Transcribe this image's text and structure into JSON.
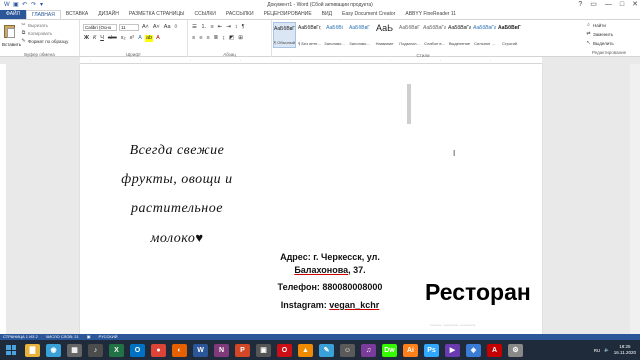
{
  "window": {
    "title": "Документ1 - Word (Сбой активации продукта)",
    "controls": [
      "?",
      "▭",
      "—",
      "□",
      "✕"
    ]
  },
  "tabs": {
    "file": "ФАЙЛ",
    "items": [
      "ГЛАВНАЯ",
      "ВСТАВКА",
      "ДИЗАЙН",
      "РАЗМЕТКА СТРАНИЦЫ",
      "ССЫЛКИ",
      "РАССЫЛКИ",
      "РЕЦЕНЗИРОВАНИЕ",
      "ВИД",
      "Easy Document Creator",
      "ABBYY FineReader 11"
    ],
    "active_index": 0
  },
  "ribbon": {
    "clipboard": {
      "paste": "Вставить",
      "cut": "Вырезать",
      "copy": "Копировать",
      "format_painter": "Формат по образцу",
      "label": "Буфер обмена"
    },
    "font": {
      "name": "Calibri (Осно",
      "size": "11",
      "label": "Шрифт"
    },
    "paragraph": {
      "label": "Абзац"
    },
    "styles": {
      "items": [
        {
          "sample": "АаБбВвГг,",
          "name": "¶ Обычный"
        },
        {
          "sample": "АаБбВвГг,",
          "name": "¶ Без инте..."
        },
        {
          "sample": "АаБбВі",
          "name": "Заголово..."
        },
        {
          "sample": "АаБбВвГ",
          "name": "Заголово..."
        },
        {
          "sample": "АаЬ",
          "name": "Название"
        },
        {
          "sample": "АаБбВвГ",
          "name": "Подзагол..."
        },
        {
          "sample": "АаБбВвГг",
          "name": "Слабое в..."
        },
        {
          "sample": "АаБбВвГг",
          "name": "Выделение"
        },
        {
          "sample": "АаБбВвГг",
          "name": "Сильное ..."
        },
        {
          "sample": "АаБбВвГг",
          "name": "Строгий"
        }
      ],
      "label": "Стили"
    },
    "editing": {
      "find": "Найти",
      "replace": "Заменить",
      "select": "Выделить",
      "label": "Редактирование"
    }
  },
  "document": {
    "script_lines": [
      "Всегда свежие",
      "фрукты, овощи и",
      "растительное",
      "молоко"
    ],
    "address_line1": "Адрес: г. Черкесск, ул.",
    "address_line2": "Балахонова",
    "address_line2_tail": ", 37.",
    "phone": "Телефон: 880080008000",
    "instagram_label": "Instagram: ",
    "instagram_handle": "vegan_kchr",
    "headline": "Ресторан"
  },
  "statusbar": {
    "page": "СТРАНИЦА 1 ИЗ 2",
    "words": "ЧИСЛО СЛОВ: 21",
    "language": "РУССКИЙ"
  },
  "taskbar": {
    "apps": [
      {
        "icon": "start-icon"
      },
      {
        "icon": "explorer-icon",
        "color": "#e8b33c",
        "glyph": "▇"
      },
      {
        "icon": "app-icon",
        "color": "#3aa0d8",
        "glyph": "◉"
      },
      {
        "icon": "calc-icon",
        "color": "#666666",
        "glyph": "▦"
      },
      {
        "icon": "media-icon",
        "color": "#4c4c4c",
        "glyph": "♪"
      },
      {
        "icon": "excel-icon",
        "color": "#217346",
        "glyph": "X"
      },
      {
        "icon": "outlook-icon",
        "color": "#0072c6",
        "glyph": "O"
      },
      {
        "icon": "chrome-icon",
        "color": "#db4437",
        "glyph": "●"
      },
      {
        "icon": "firefox-icon",
        "color": "#e66000",
        "glyph": "◐"
      },
      {
        "icon": "word-icon",
        "color": "#2b579a",
        "glyph": "W"
      },
      {
        "icon": "onenote-icon",
        "color": "#80397b",
        "glyph": "N"
      },
      {
        "icon": "powerpoint-icon",
        "color": "#d24726",
        "glyph": "P"
      },
      {
        "icon": "viewer-icon",
        "color": "#555555",
        "glyph": "▣"
      },
      {
        "icon": "opera-icon",
        "color": "#cc0f16",
        "glyph": "O"
      },
      {
        "icon": "vlc-icon",
        "color": "#f08a00",
        "glyph": "▲"
      },
      {
        "icon": "paint-icon",
        "color": "#3aa0d8",
        "glyph": "✎"
      },
      {
        "icon": "chat-icon",
        "color": "#5a5a5a",
        "glyph": "☺"
      },
      {
        "icon": "music-icon",
        "color": "#7a3b9a",
        "glyph": "♫"
      },
      {
        "icon": "dreamweaver-icon",
        "color": "#35fa00",
        "glyph": "Dw"
      },
      {
        "icon": "illustrator-icon",
        "color": "#ff7f18",
        "glyph": "Ai"
      },
      {
        "icon": "photoshop-icon",
        "color": "#31a8ff",
        "glyph": "Ps"
      },
      {
        "icon": "video-icon",
        "color": "#6a3ab0",
        "glyph": "▶"
      },
      {
        "icon": "browser-icon",
        "color": "#3a7bd5",
        "glyph": "◈"
      },
      {
        "icon": "acrobat-icon",
        "color": "#c40000",
        "glyph": "A"
      },
      {
        "icon": "tool-icon",
        "color": "#888888",
        "glyph": "⚙"
      }
    ],
    "lang": "RU",
    "time": "18:25",
    "date": "16.11.2020"
  }
}
